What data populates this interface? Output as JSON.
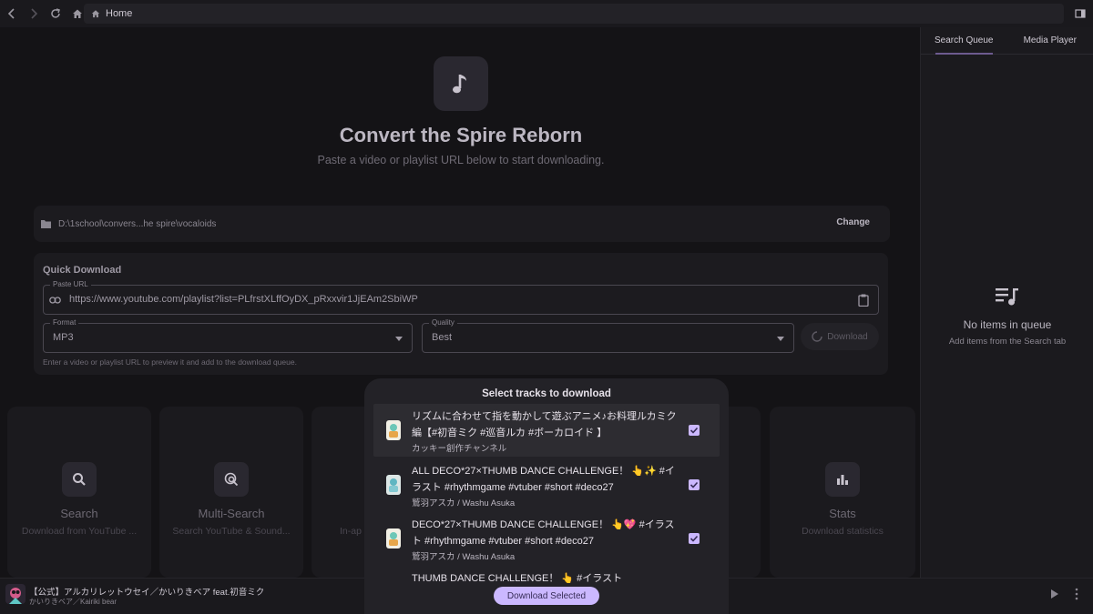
{
  "topbar": {
    "breadcrumb": "Home"
  },
  "hero": {
    "title": "Convert the Spire Reborn",
    "subtitle": "Paste a video or playlist URL below to start downloading."
  },
  "folder": {
    "path": "D:\\1school\\convers...he spire\\vocaloids",
    "change_label": "Change"
  },
  "quick_download": {
    "title": "Quick Download",
    "url_label": "Paste URL",
    "url_value": "https://www.youtube.com/playlist?list=PLfrstXLffOyDX_pRxxvir1JjEAm2SbiWP",
    "format_label": "Format",
    "format_value": "MP3",
    "quality_label": "Quality",
    "quality_value": "Best",
    "download_label": "Download",
    "hint": "Enter a video or playlist URL to preview it and add to the download queue."
  },
  "cards": [
    {
      "title": "Search",
      "desc": "Download from YouTube ...",
      "icon": "search-icon"
    },
    {
      "title": "Multi-Search",
      "desc": "Search YouTube & Sound...",
      "icon": "multi-search-icon"
    },
    {
      "title": "",
      "desc": "In-ap",
      "icon": ""
    },
    {
      "title": "Stats",
      "desc": "Download statistics",
      "icon": "bar-chart-icon"
    }
  ],
  "right_panel": {
    "tabs": [
      "Search Queue",
      "Media Player"
    ],
    "empty_title": "No items in queue",
    "empty_subtitle": "Add items from the Search tab"
  },
  "dialog": {
    "title": "Select tracks to download",
    "tracks": [
      {
        "title": "リズムに合わせて指を動かして遊ぶアニメ♪お料理ルカミク編【#初音ミク #巡音ルカ #ボーカロイド 】",
        "artist": "カッキー創作チャンネル",
        "checked": true
      },
      {
        "title": "ALL DECO*27×THUMB DANCE CHALLENGE！ 👆✨ #イラスト  #rhythmgame #vtuber #short #deco27",
        "artist": "鷲羽アスカ / Washu Asuka",
        "checked": true
      },
      {
        "title": "DECO*27×THUMB DANCE CHALLENGE！ 👆💖 #イラスト  #rhythmgame #vtuber #short #deco27",
        "artist": "鷲羽アスカ / Washu Asuka",
        "checked": true
      },
      {
        "title": "THUMB DANCE CHALLENGE！ 👆 #イラスト",
        "artist": "",
        "checked": true
      }
    ],
    "download_selected_label": "Download Selected"
  },
  "player": {
    "title": "【公式】アルカリレットウセイ／かいりきベア feat.初音ミク",
    "artist": "かいりきベア／Kairiki bear"
  },
  "colors": {
    "accent": "#cbb8ff",
    "background": "#141316",
    "dialog": "#232227"
  }
}
